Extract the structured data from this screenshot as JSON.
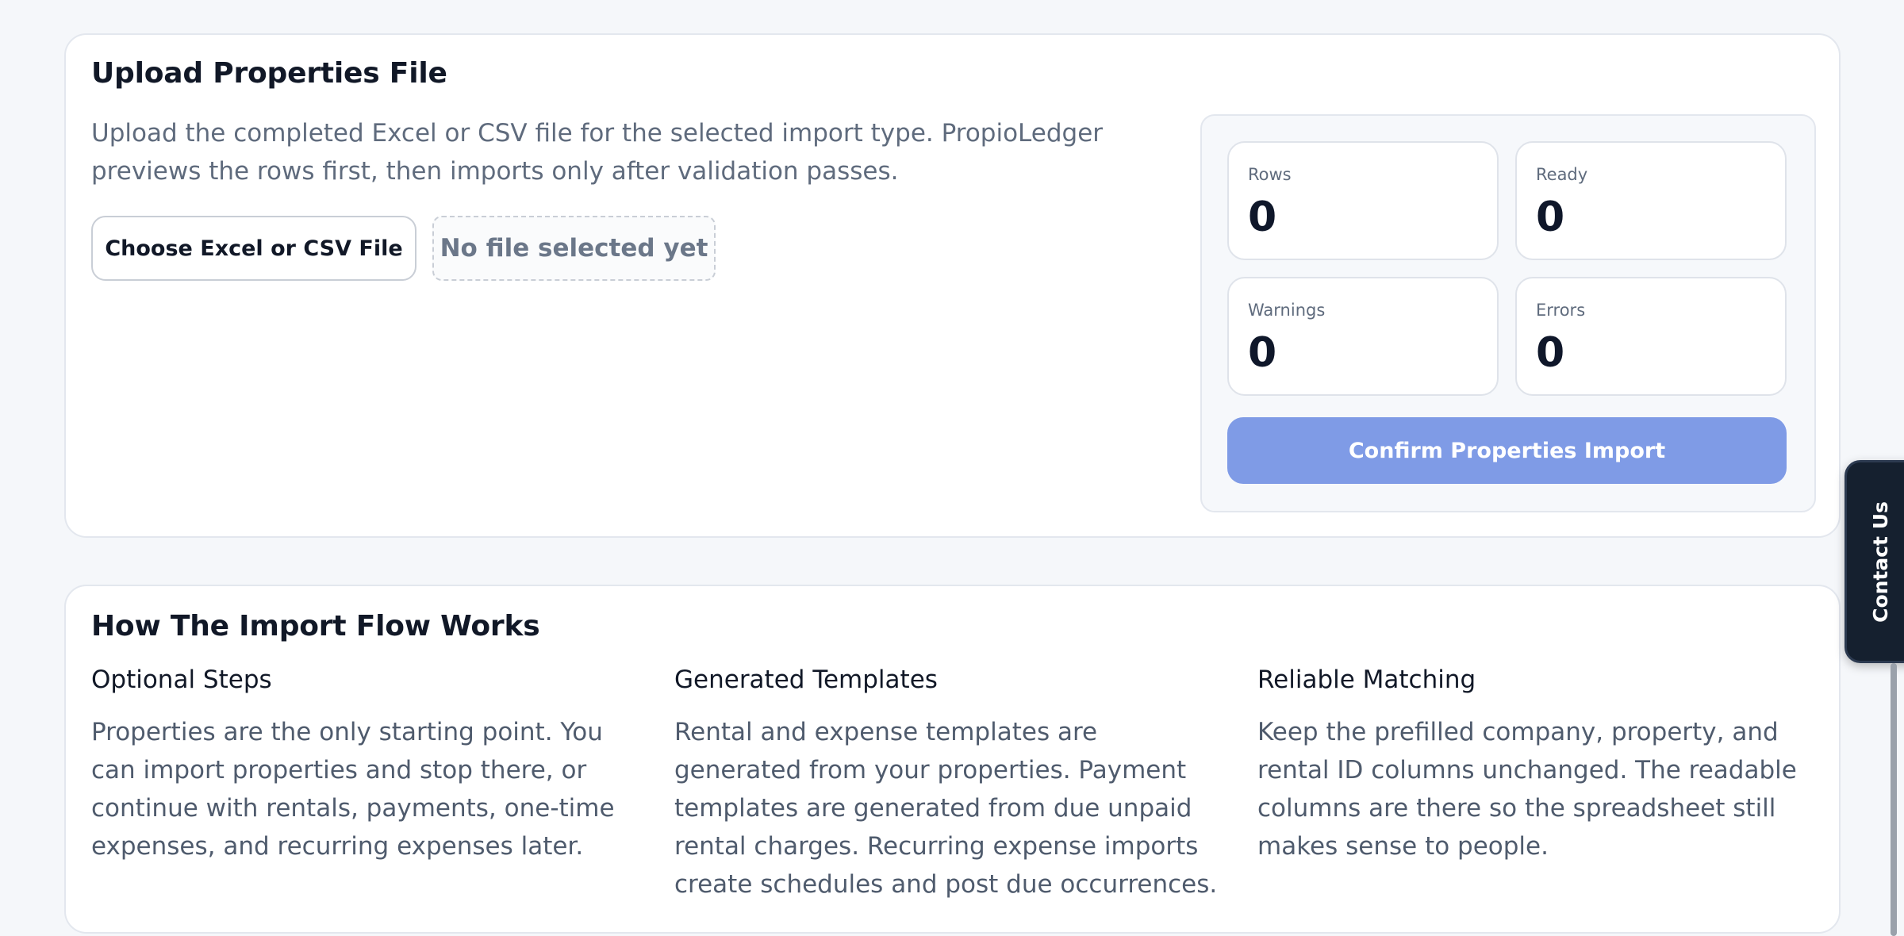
{
  "upload": {
    "title": "Upload Properties File",
    "description": "Upload the completed Excel or CSV file for the selected import type. PropioLedger previews the rows first, then imports only after validation passes.",
    "choose_label": "Choose Excel or CSV File",
    "file_status": "No file selected yet",
    "stats": {
      "rows": {
        "label": "Rows",
        "value": "0"
      },
      "ready": {
        "label": "Ready",
        "value": "0"
      },
      "warnings": {
        "label": "Warnings",
        "value": "0"
      },
      "errors": {
        "label": "Errors",
        "value": "0"
      }
    },
    "confirm_label": "Confirm Properties Import"
  },
  "flow": {
    "title": "How The Import Flow Works",
    "columns": [
      {
        "heading": "Optional Steps",
        "text": "Properties are the only starting point. You can import properties and stop there, or continue with rentals, payments, one-time expenses, and recurring expenses later."
      },
      {
        "heading": "Generated Templates",
        "text": "Rental and expense templates are generated from your properties. Payment templates are generated from due unpaid rental charges. Recurring expense imports create schedules and post due occurrences."
      },
      {
        "heading": "Reliable Matching",
        "text": "Keep the prefilled company, property, and rental ID columns unchanged. The readable columns are there so the spreadsheet still makes sense to people."
      }
    ]
  },
  "contact": {
    "label": "Contact Us"
  },
  "colors": {
    "confirm_button": "#7f9be6",
    "contact_tab": "#15202f",
    "page_background": "#f5f7fa"
  }
}
